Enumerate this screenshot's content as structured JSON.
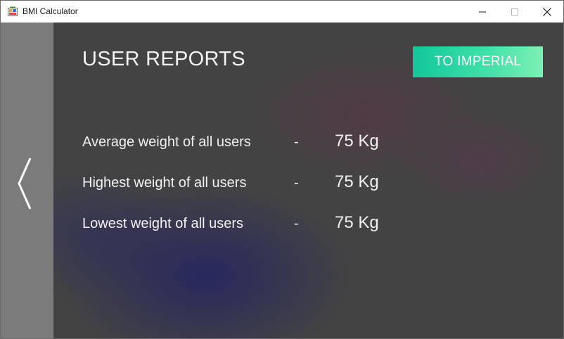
{
  "window": {
    "title": "BMI Calculator",
    "icon": "app-icon",
    "controls": [
      "minimize-icon",
      "maximize-icon",
      "close-icon"
    ]
  },
  "page": {
    "title": "USER REPORTS",
    "unit_toggle_label": "TO IMPERIAL",
    "back_icon": "chevron-left-icon"
  },
  "reports": [
    {
      "label": "Average weight of all users",
      "separator": "-",
      "value": "75 Kg"
    },
    {
      "label": "Highest weight of all users",
      "separator": "-",
      "value": "75 Kg"
    },
    {
      "label": "Lowest weight of all users",
      "separator": "-",
      "value": "75 Kg"
    }
  ],
  "colors": {
    "background": "#434343",
    "sidebar": "#7b7b7b",
    "button_gradient_start": "#12c79a",
    "button_gradient_end": "#7df0b4",
    "text": "#f0f0f0"
  }
}
